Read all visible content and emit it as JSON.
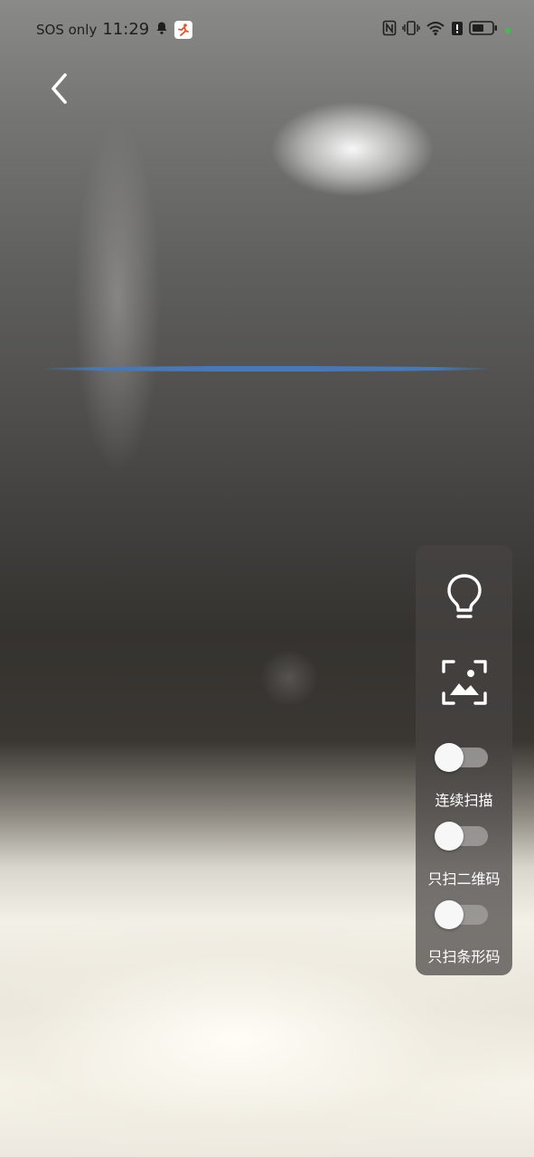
{
  "status_bar": {
    "carrier": "SOS only",
    "time": "11:29",
    "icons": [
      "bell-icon",
      "app-notification-icon",
      "nfc-icon",
      "vibrate-icon",
      "wifi-icon",
      "battery-saver-icon",
      "battery-icon",
      "privacy-dot-icon"
    ]
  },
  "toolbar": {
    "back_icon": "chevron-left-icon"
  },
  "scanner": {
    "scan_line_color": "#4a78b5"
  },
  "panel": {
    "flashlight_icon": "lightbulb-icon",
    "gallery_icon": "gallery-scan-icon",
    "toggles": [
      {
        "label": "连续扫描",
        "on": false
      },
      {
        "label": "只扫二维码",
        "on": false
      },
      {
        "label": "只扫条形码",
        "on": false
      }
    ]
  }
}
